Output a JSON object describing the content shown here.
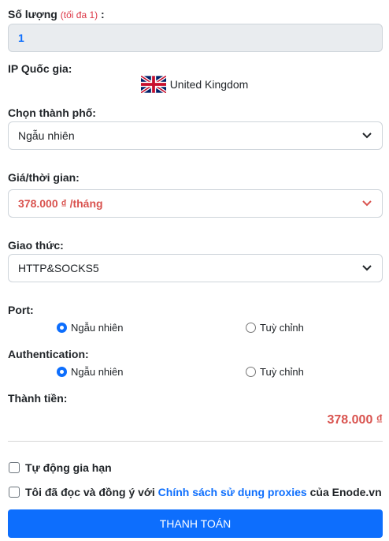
{
  "quantity": {
    "label": "Số lượng",
    "hint": "(tối đa 1)",
    "colon": ":",
    "value": "1"
  },
  "country": {
    "label": "IP Quốc gia:",
    "name": "United Kingdom",
    "flag_icon": "uk-flag-icon"
  },
  "city": {
    "label": "Chọn thành phố:",
    "selected": "Ngẫu nhiên"
  },
  "price": {
    "label": "Giá/thời gian:",
    "selected": "378.000 ₫ /tháng"
  },
  "protocol": {
    "label": "Giao thức:",
    "selected": "HTTP&SOCKS5"
  },
  "port": {
    "label": "Port:",
    "options": [
      "Ngẫu nhiên",
      "Tuỳ chỉnh"
    ],
    "selected": "Ngẫu nhiên"
  },
  "auth": {
    "label": "Authentication:",
    "options": [
      "Ngẫu nhiên",
      "Tuỳ chỉnh"
    ],
    "selected": "Ngẫu nhiên"
  },
  "total": {
    "label": "Thành tiền:",
    "value": "378.000 ₫"
  },
  "auto_renew": {
    "label": "Tự động gia hạn",
    "checked": false
  },
  "agree": {
    "prefix": "Tôi đã đọc và đồng ý với ",
    "link": "Chính sách sử dụng proxies",
    "suffix": " của Enode.vn",
    "checked": false
  },
  "pay_button": "THANH TOÁN",
  "colors": {
    "primary": "#0d6efd",
    "price": "#d9534f",
    "hint": "#dc3545"
  }
}
